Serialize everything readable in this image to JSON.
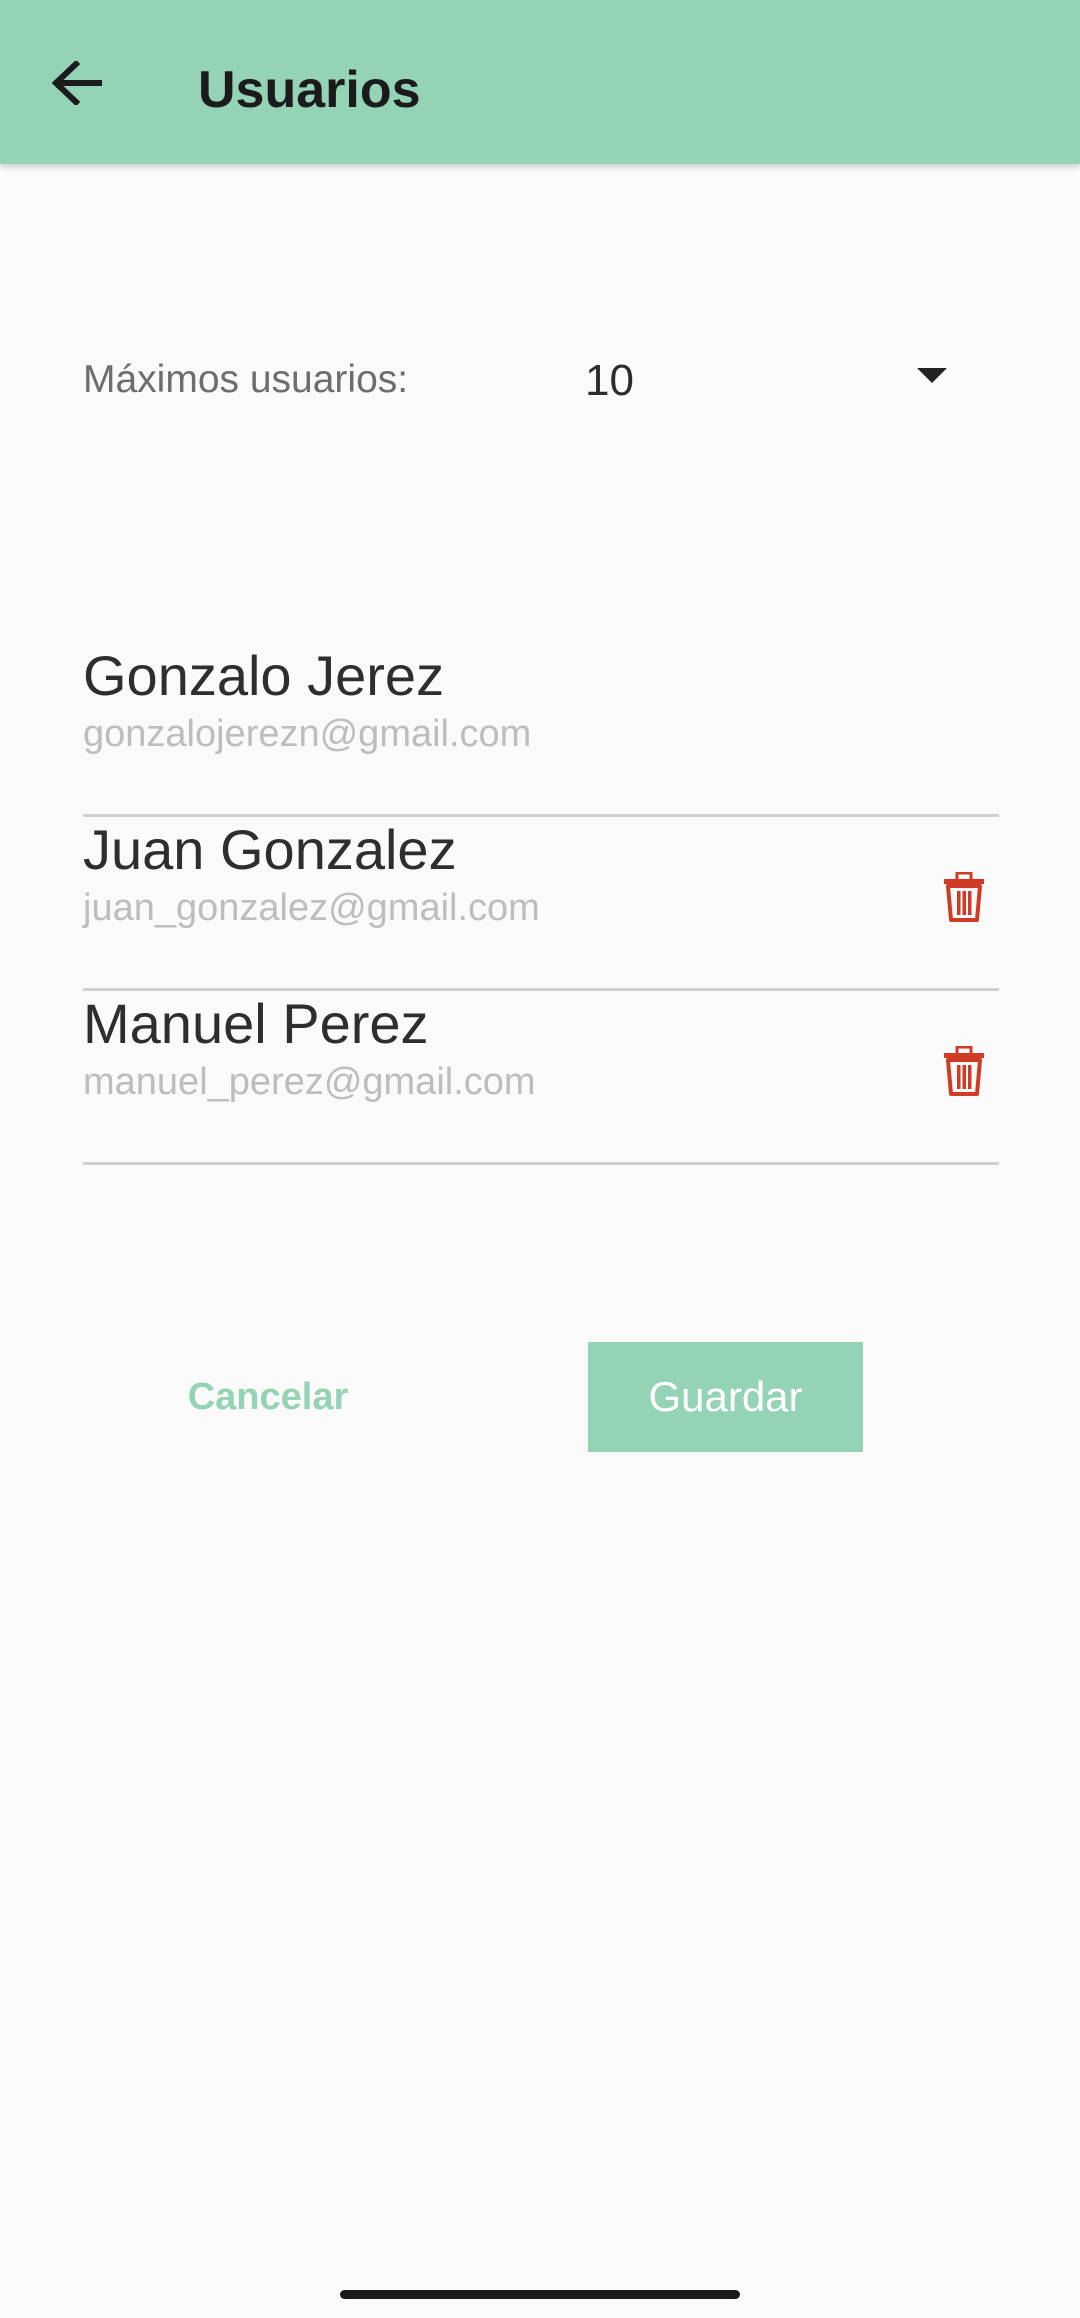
{
  "app_bar": {
    "title": "Usuarios",
    "back_icon": "arrow-back-icon",
    "background_color": "#94d3b6"
  },
  "settings": {
    "max_users_label": "Máximos usuarios:",
    "max_users_value": "10"
  },
  "users": [
    {
      "name": "Gonzalo Jerez",
      "email": "gonzalojerezn@gmail.com",
      "deletable": false
    },
    {
      "name": "Juan Gonzalez",
      "email": "juan_gonzalez@gmail.com",
      "deletable": true
    },
    {
      "name": "Manuel Perez",
      "email": "manuel_perez@gmail.com",
      "deletable": true
    }
  ],
  "actions": {
    "cancel_label": "Cancelar",
    "save_label": "Guardar"
  },
  "colors": {
    "accent": "#94d3b6",
    "delete_icon": "#d03b25"
  }
}
